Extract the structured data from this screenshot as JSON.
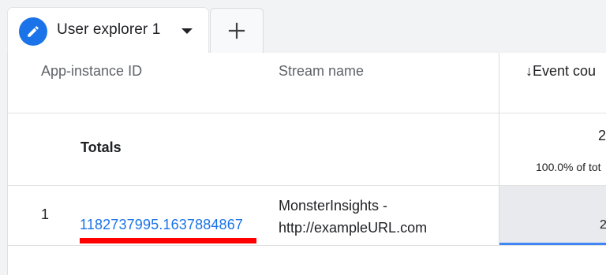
{
  "tabs": {
    "active_title": "User explorer 1",
    "add_icon": "plus-icon",
    "edit_icon": "pencil-icon"
  },
  "table": {
    "headers": {
      "app_instance_id": "App-instance ID",
      "stream_name": "Stream name",
      "event_count": "↓Event cou"
    },
    "totals": {
      "label": "Totals",
      "event_count": "2",
      "percent_of_total": "100.0% of tot"
    },
    "rows": [
      {
        "index": "1",
        "app_instance_id": "1182737995.1637884867",
        "stream_name_line1": "MonsterInsights -",
        "stream_name_line2": "http://exampleURL.com",
        "event_count": "2",
        "event_share": 1.0
      }
    ]
  },
  "colors": {
    "accent": "#1a73e8",
    "highlight_underline": "#ff0000",
    "bar": "#4285f4"
  }
}
